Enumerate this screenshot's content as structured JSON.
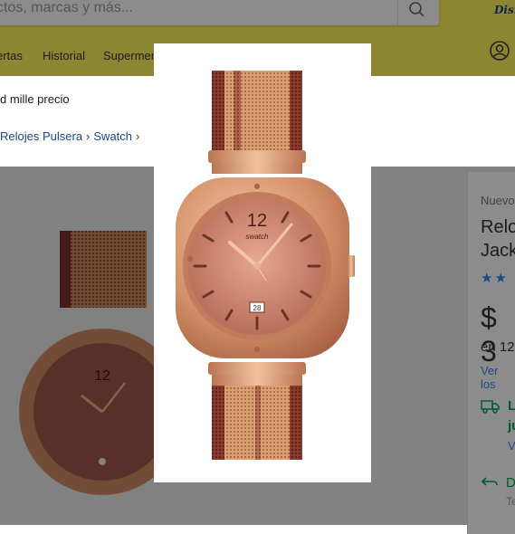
{
  "header": {
    "search_placeholder": "ctos, marcas y más...",
    "partner_logo": "Disney",
    "nav_items": [
      "ertas",
      "Historial",
      "Supermerc"
    ]
  },
  "announcement": "d mille precio",
  "breadcrumb": [
    "Relojes Pulsera",
    "Swatch"
  ],
  "product": {
    "condition": "Nuevo",
    "title_line1": "Reloj",
    "title_line2": "Jack",
    "stars": "★★",
    "price": "$ 3",
    "installments": "en 12",
    "payment_link": "Ver los",
    "shipping_line1": "L",
    "shipping_line2": "ju",
    "shipping_link": "V",
    "return_title": "D",
    "return_sub": "Te"
  },
  "modal": {
    "watch_brand": "swatch",
    "dial_number": "12",
    "date_value": "28"
  },
  "colors": {
    "yellow_bar": "#fff159",
    "link_blue": "#3483fa",
    "green": "#00a650",
    "rose_gold": "#e0a07e"
  }
}
